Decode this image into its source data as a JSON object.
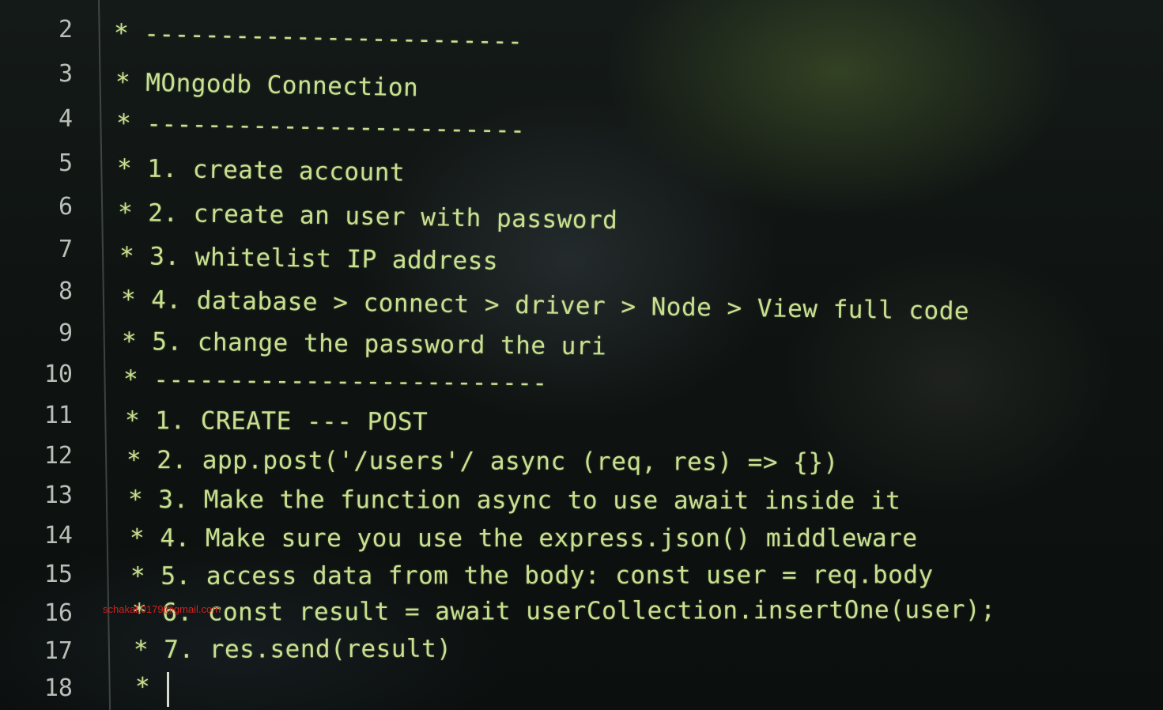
{
  "editor": {
    "lines": [
      {
        "number": "2",
        "text": "* -------------------------"
      },
      {
        "number": "3",
        "text": "* MOngodb Connection"
      },
      {
        "number": "4",
        "text": "* -------------------------"
      },
      {
        "number": "5",
        "text": "* 1. create account"
      },
      {
        "number": "6",
        "text": "* 2. create an user with password"
      },
      {
        "number": "7",
        "text": "* 3. whitelist IP address"
      },
      {
        "number": "8",
        "text": "* 4. database > connect > driver > Node > View full code"
      },
      {
        "number": "9",
        "text": "* 5. change the password the uri"
      },
      {
        "number": "10",
        "text": "* --------------------------"
      },
      {
        "number": "11",
        "text": "* 1. CREATE --- POST"
      },
      {
        "number": "12",
        "text": "* 2. app.post('/users'/ async (req, res) => {})"
      },
      {
        "number": "13",
        "text": "* 3. Make the function async to use await inside it"
      },
      {
        "number": "14",
        "text": "* 4. Make sure you use the express.json() middleware"
      },
      {
        "number": "15",
        "text": "* 5. access data from the body: const user = req.body"
      },
      {
        "number": "16",
        "text": "* 6. const result = await userCollection.insertOne(user);"
      },
      {
        "number": "17",
        "text": "* 7. res.send(result)"
      },
      {
        "number": "18",
        "text": "*"
      }
    ]
  },
  "watermark": {
    "text": "schakal.0179@gmail.com"
  },
  "colors": {
    "code_text": "#c8e08f",
    "line_number": "#b9bfb8",
    "background": "#0d1110",
    "watermark": "#e02020"
  }
}
